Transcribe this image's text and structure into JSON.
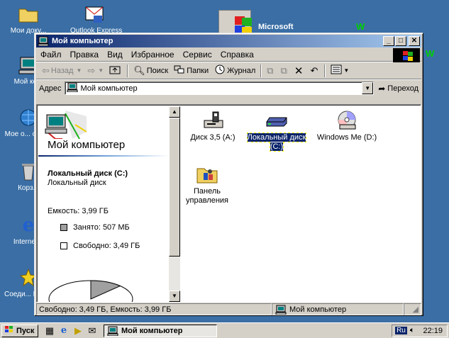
{
  "desktop": {
    "icons": [
      {
        "label": "Мои доку...",
        "icon": "folder-icon"
      },
      {
        "label": "Outlook Express",
        "icon": "outlook-icon"
      },
      {
        "label": "Мой ко...",
        "icon": "computer-icon"
      },
      {
        "label": "Мое о... окру...",
        "icon": "network-icon"
      },
      {
        "label": "Корз...",
        "icon": "recycle-bin-icon"
      },
      {
        "label": "Internet...",
        "icon": "ie-icon"
      },
      {
        "label": "Соеди... Интер...",
        "icon": "connect-icon"
      }
    ],
    "banner_text": "Microsoft",
    "side_text_1": "W",
    "side_text_2": "W"
  },
  "window": {
    "title": "Мой компьютер",
    "menu": [
      "Файл",
      "Правка",
      "Вид",
      "Избранное",
      "Сервис",
      "Справка"
    ],
    "toolbar": {
      "back": "Назад",
      "forward": "",
      "search": "Поиск",
      "folders": "Папки",
      "history": "Журнал"
    },
    "address": {
      "label": "Адрес",
      "value": "Мой компьютер",
      "go": "Переход"
    },
    "left_pane": {
      "title": "Мой компьютер",
      "selected_name": "Локальный диск (C:)",
      "selected_type": "Локальный диск",
      "capacity": "Емкость: 3,99 ГБ",
      "used": "Занято: 507 МБ",
      "free": "Свободно: 3,49 ГБ",
      "used_fraction": 0.124,
      "used_color": "#a0a0a0",
      "free_color": "#ffffff"
    },
    "items": [
      {
        "label": "Диск 3,5 (A:)",
        "icon": "floppy-drive-icon",
        "selected": false
      },
      {
        "label": "Локальный диск (C:)",
        "icon": "hard-drive-icon",
        "selected": true
      },
      {
        "label": "Windows Me (D:)",
        "icon": "cd-drive-icon",
        "selected": false
      },
      {
        "label": "Панель управления",
        "icon": "control-panel-icon",
        "selected": false
      }
    ],
    "status": {
      "left": "Свободно: 3,49 ГБ, Емкость: 3,99 ГБ",
      "zone": "Мой компьютер"
    }
  },
  "taskbar": {
    "start": "Пуск",
    "task": "Мой компьютер",
    "lang": "Ru",
    "clock": "22:19"
  },
  "colors": {
    "desktop": "#3a6ea5",
    "title_active": "#0a246a",
    "face": "#d4d0c8"
  }
}
